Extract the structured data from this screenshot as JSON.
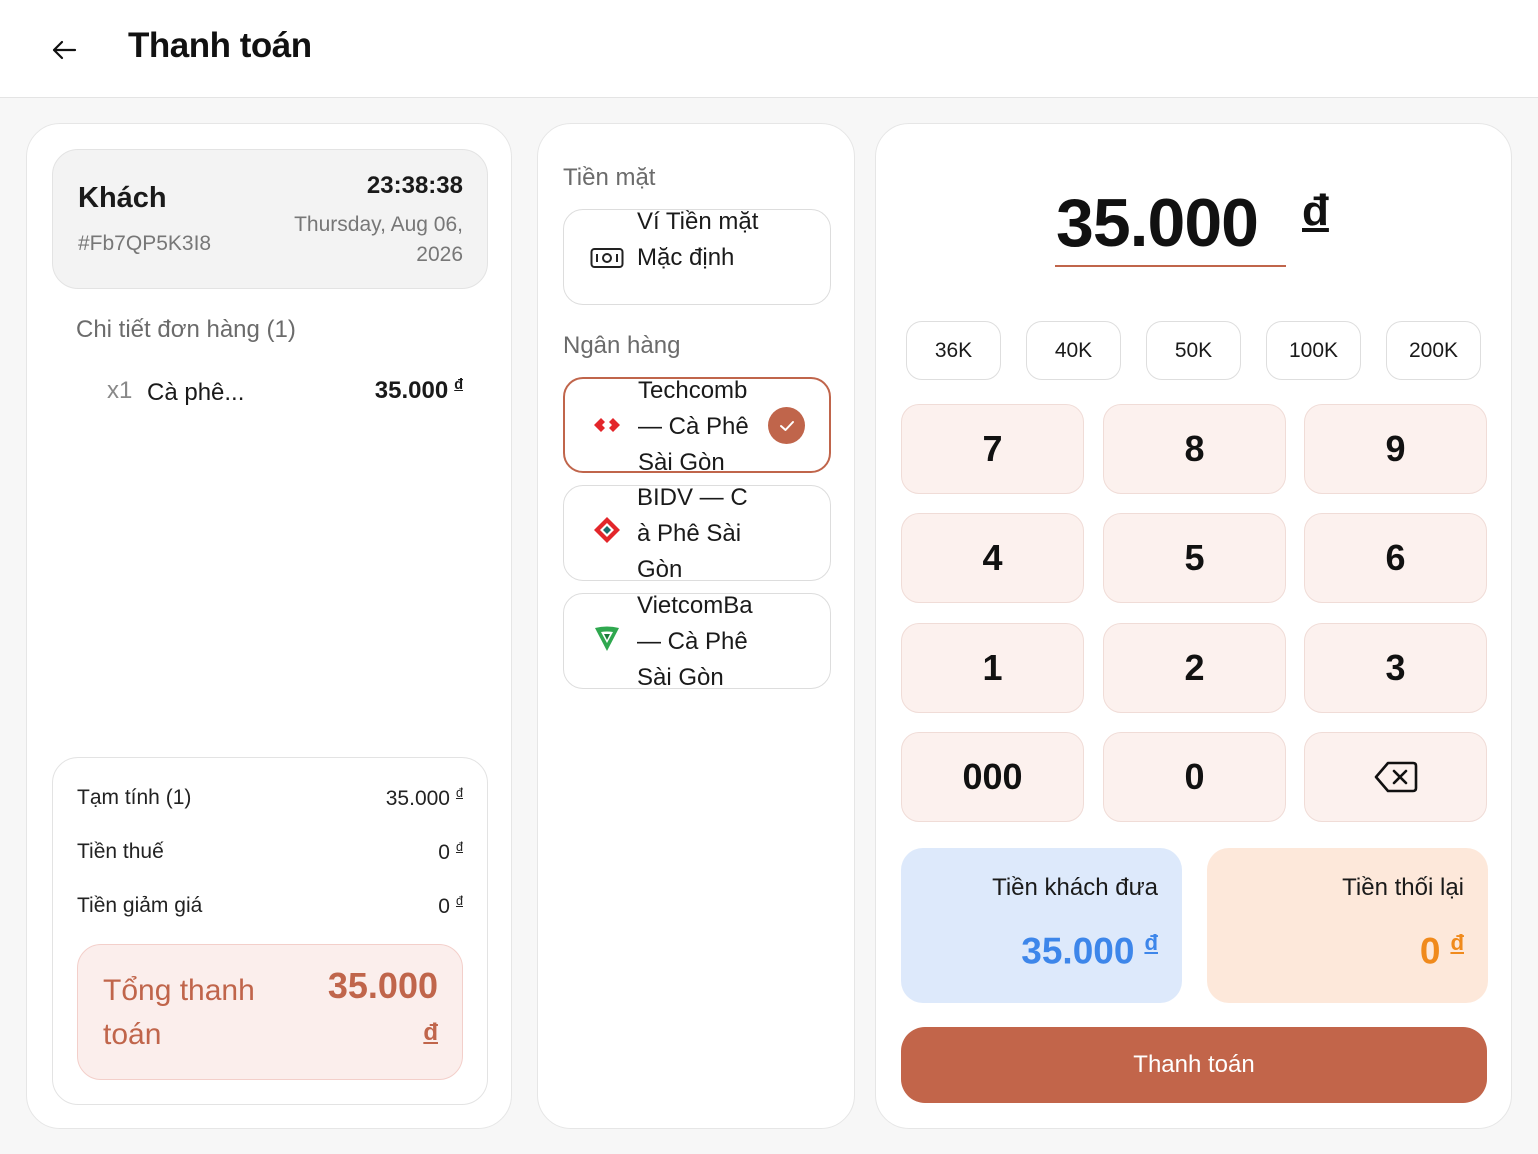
{
  "header": {
    "back_icon": "arrow-left-icon",
    "title": "Thanh toán"
  },
  "order": {
    "customer_name": "Khách",
    "customer_code": "#Fb7QP5K3I8",
    "time": "23:38:38",
    "date": "Thursday, Aug 06, 2026",
    "detail_title": "Chi tiết đơn hàng (1)",
    "items": [
      {
        "qty": "x1",
        "name": "Cà phê...",
        "price": "35.000",
        "currency": "đ"
      }
    ]
  },
  "summary": {
    "rows": [
      {
        "label": "Tạm tính (1)",
        "value": "35.000",
        "currency": "đ"
      },
      {
        "label": "Tiền thuế",
        "value": "0",
        "currency": "đ"
      },
      {
        "label": "Tiền giảm giá",
        "value": "0",
        "currency": "đ"
      }
    ],
    "total_label": "Tổng thanh toán",
    "total_value": "35.000",
    "total_currency": "đ"
  },
  "payment_methods": {
    "cash_title": "Tiền mặt",
    "bank_title": "Ngân hàng",
    "cash": [
      {
        "label": "Ví Tiền mặt Mặc định",
        "icon": "cash-icon",
        "selected": false
      }
    ],
    "banks": [
      {
        "label": "Techcomb — Cà Phê Sài Gòn",
        "icon": "techcombank-logo-icon",
        "selected": true
      },
      {
        "label": "BIDV — Cà Phê Sài Gòn",
        "icon": "bidv-logo-icon",
        "selected": false
      },
      {
        "label": "VietcomBa — Cà Phê Sài Gòn",
        "icon": "vietcombank-logo-icon",
        "selected": false
      }
    ]
  },
  "amount": {
    "value": "35.000",
    "currency": "đ"
  },
  "quick_amounts": [
    "36K",
    "40K",
    "50K",
    "100K",
    "200K"
  ],
  "keypad": {
    "keys": [
      "7",
      "8",
      "9",
      "4",
      "5",
      "6",
      "1",
      "2",
      "3",
      "000",
      "0"
    ],
    "backspace_icon": "backspace-icon"
  },
  "given": {
    "label": "Tiền khách đưa",
    "value": "35.000",
    "currency": "đ"
  },
  "change": {
    "label": "Tiền thối lại",
    "value": "0",
    "currency": "đ"
  },
  "pay_button": "Thanh toán",
  "colors": {
    "accent": "#c2654a",
    "given_bg": "#dde9fb",
    "given_text": "#3d86ea",
    "change_bg": "#fde8da",
    "change_text": "#f08a1c",
    "key_bg": "#fcf1ee"
  }
}
